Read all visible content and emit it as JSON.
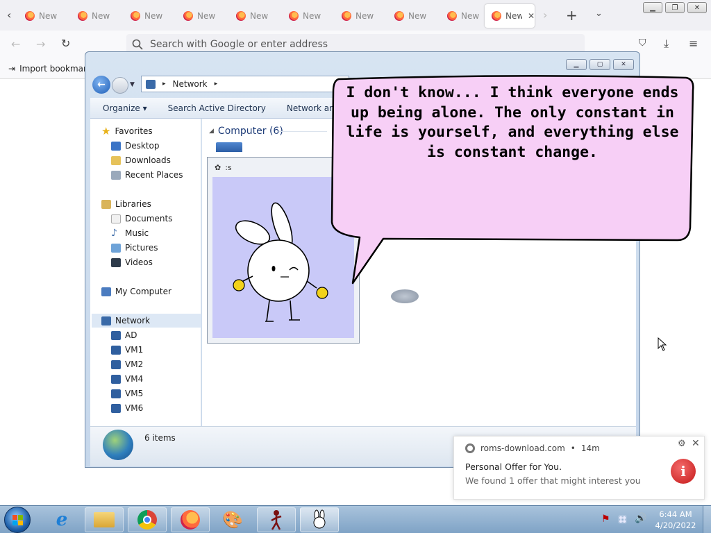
{
  "browser": {
    "tabs": [
      {
        "label": "New T"
      },
      {
        "label": "New T"
      },
      {
        "label": "New T"
      },
      {
        "label": "New T"
      },
      {
        "label": "New T"
      },
      {
        "label": "New T"
      },
      {
        "label": "New T"
      },
      {
        "label": "New T"
      },
      {
        "label": "New T"
      },
      {
        "label": "New T"
      }
    ],
    "active_tab_index": 9,
    "address_placeholder": "Search with Google or enter address",
    "bookmark_import_label": "Import bookmark"
  },
  "explorer": {
    "address_path": "Network",
    "toolbar": {
      "organize": "Organize",
      "search_ad": "Search Active Directory",
      "network_and_sharing": "Network and Sh"
    },
    "nav": {
      "favorites": "Favorites",
      "favorites_items": [
        "Desktop",
        "Downloads",
        "Recent Places"
      ],
      "libraries": "Libraries",
      "libraries_items": [
        "Documents",
        "Music",
        "Pictures",
        "Videos"
      ],
      "my_computer": "My Computer",
      "network": "Network",
      "network_items": [
        "AD",
        "VM1",
        "VM2",
        "VM4",
        "VM5",
        "VM6"
      ]
    },
    "group_header": "Computer (6)",
    "status_items": "6 items"
  },
  "viewer": {
    "title": ":s"
  },
  "speech_bubble": {
    "text": "I don't know... I think everyone ends up being alone. The only constant in life is yourself, and everything else is constant change."
  },
  "notification": {
    "source": "roms-download.com",
    "age": "14m",
    "title": "Personal Offer for You.",
    "body": "We found 1 offer that might interest you"
  },
  "taskbar": {
    "apps": [
      "internet-explorer",
      "file-explorer",
      "chrome",
      "firefox",
      "paint",
      "stick-figure-app",
      "bunny-app"
    ],
    "clock_time": "6:44 AM",
    "clock_date": "4/20/2022"
  }
}
